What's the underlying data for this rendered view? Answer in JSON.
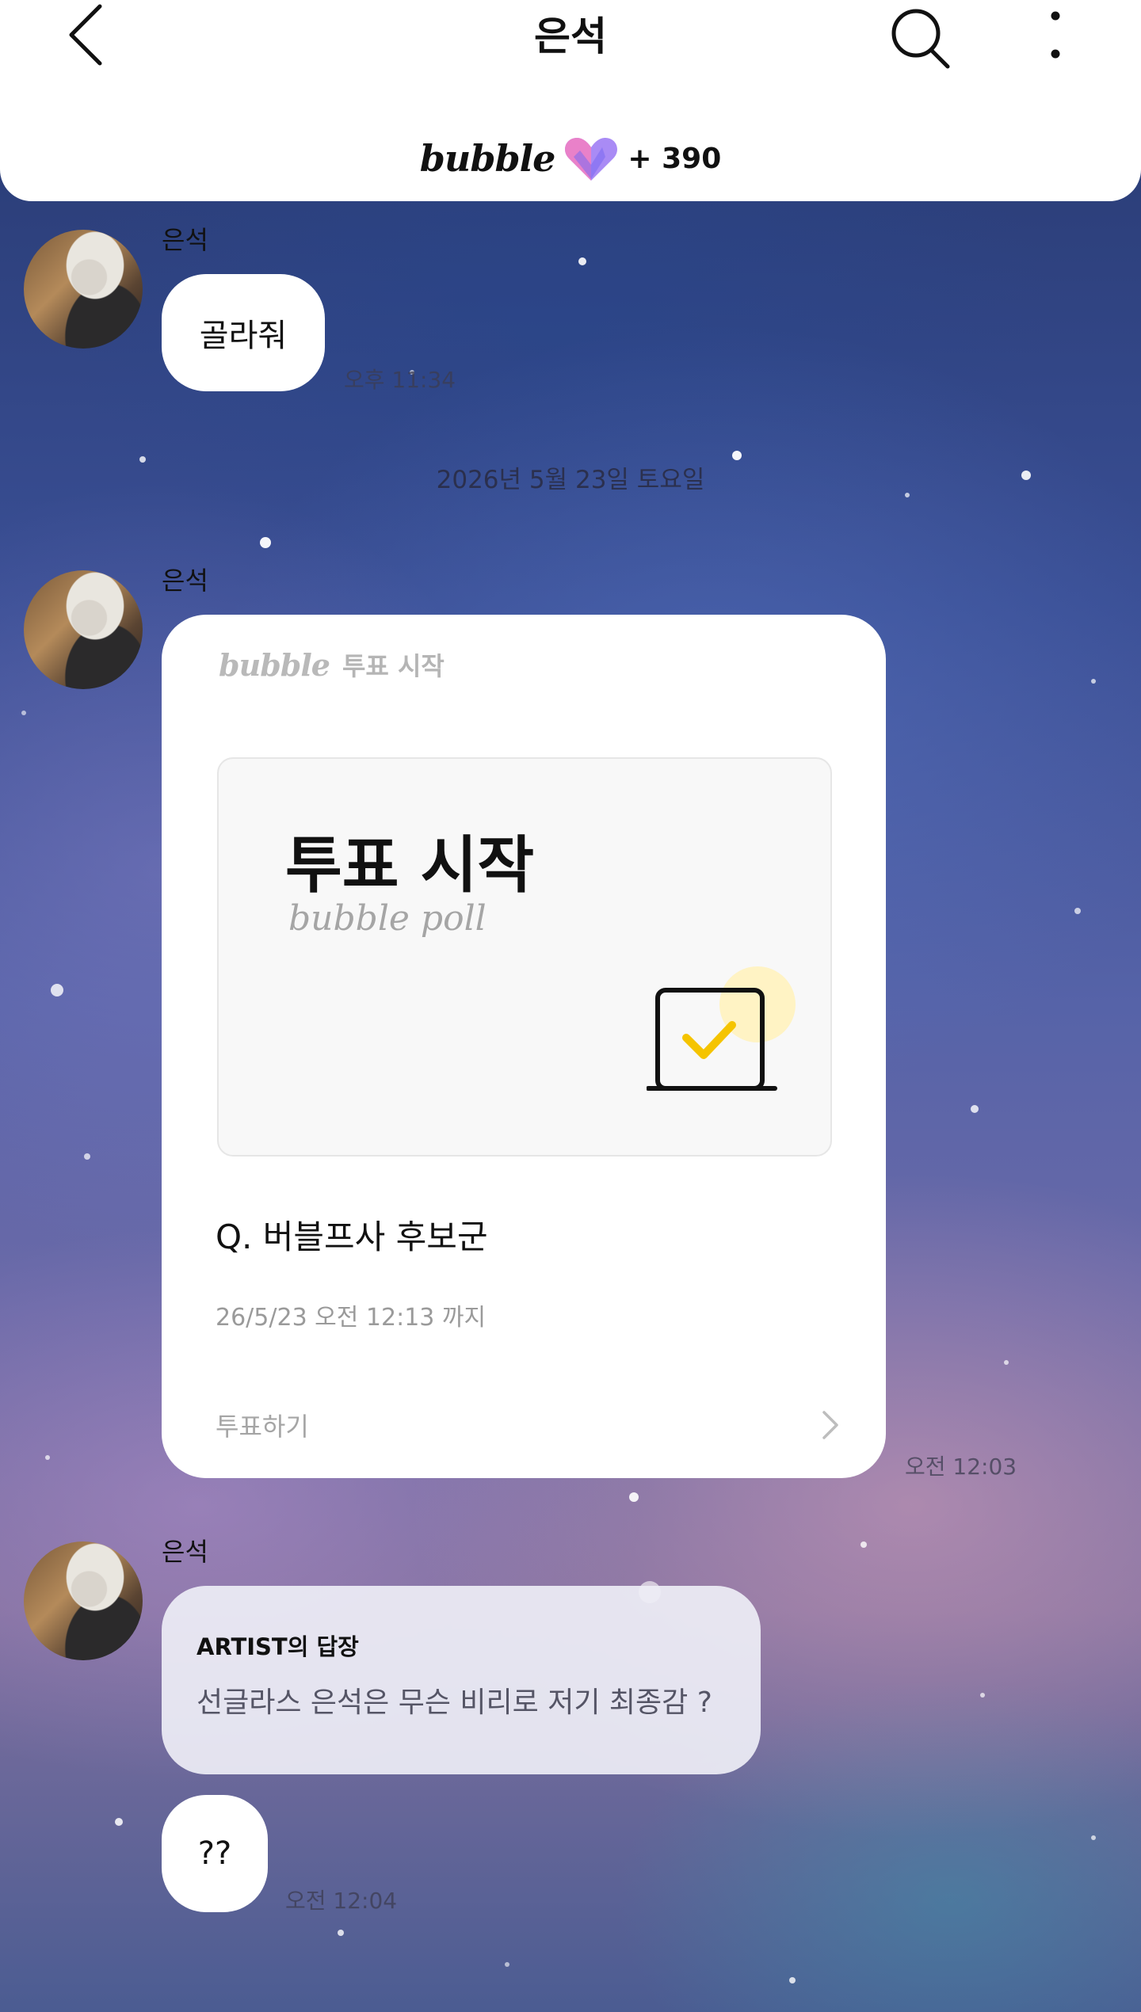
{
  "header": {
    "title": "은석",
    "brand": "bubble",
    "count": "+ 390",
    "icons": [
      "back-icon",
      "search-icon",
      "more-vertical-icon",
      "heart-icon"
    ]
  },
  "messages": {
    "first": {
      "sender": "은석",
      "text": "골라줘",
      "time": "오후 11:34"
    },
    "date_divider": "2026년 5월 23일 토요일",
    "poll": {
      "sender": "은석",
      "header_brand": "bubble",
      "header_label": "투표 시작",
      "banner_title": "투표 시작",
      "banner_subtitle": "bubble poll",
      "question": "Q. 버블프사 후보군",
      "deadline": "26/5/23 오전 12:13 까지",
      "action_label": "투표하기",
      "time": "오전 12:03",
      "accent_color": "#f5c400"
    },
    "reply": {
      "sender": "은석",
      "label": "ARTIST의 답장",
      "text": "선글라스 은석은 무슨 비리로 저기 최종감 ?"
    },
    "last": {
      "text": "??",
      "time": "오전 12:04"
    }
  }
}
